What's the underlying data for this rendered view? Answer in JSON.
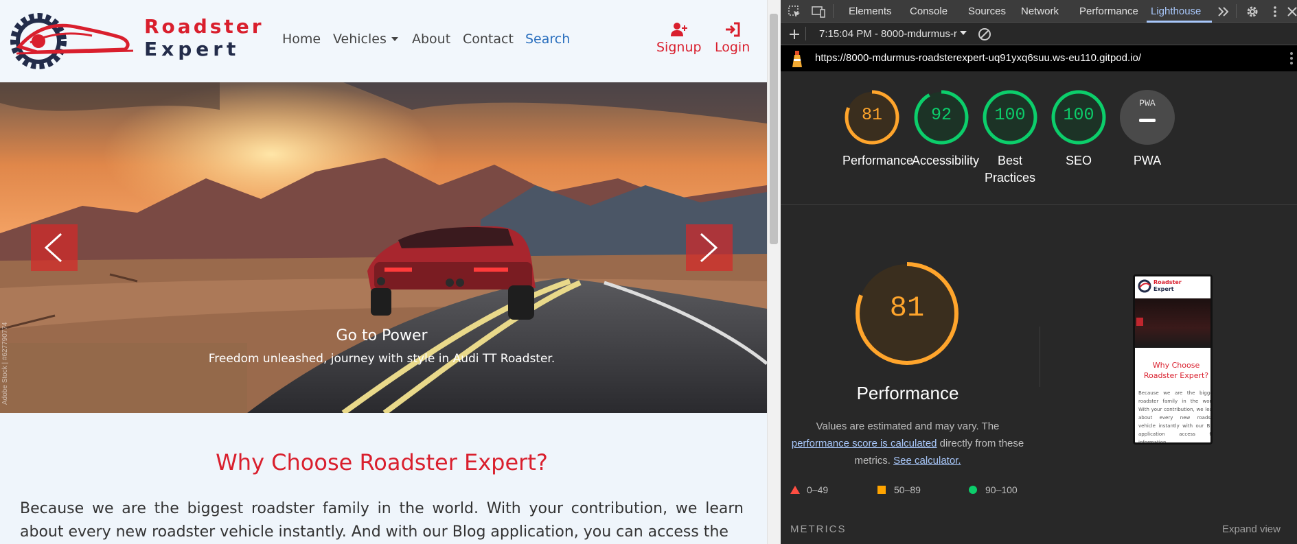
{
  "site": {
    "brand": {
      "line1": "Roadster",
      "line2": "Expert"
    },
    "nav": {
      "home": "Home",
      "vehicles": "Vehicles",
      "about": "About",
      "contact": "Contact",
      "search": "Search",
      "signup": "Signup",
      "login": "Login"
    },
    "hero": {
      "title": "Go to Power",
      "subtitle": "Freedom unleashed, journey with style in Audi TT Roadster.",
      "watermark": "Adobe Stock | #627790774"
    },
    "why": {
      "title": "Why Choose Roadster Expert?",
      "text": "Because we are the biggest roadster family in the world. With your contribution, we learn about every new roadster vehicle instantly. And with our Blog application, you can access the"
    },
    "colors": {
      "accent": "#d91f2d",
      "navy": "#232c4a",
      "link": "#2a6fbe"
    }
  },
  "devtools": {
    "tabs": [
      "Elements",
      "Console",
      "Sources",
      "Network",
      "Performance",
      "Lighthouse"
    ],
    "active_tab": "Lighthouse",
    "report_time": "7:15:04 PM - 8000-mdurmus-r",
    "url": "https://8000-mdurmus-roadsterexpert-uq91yxq6suu.ws-eu110.gitpod.io/",
    "scores": [
      {
        "label": "Performance",
        "value": "81",
        "level": "average",
        "color": "#ffa52c"
      },
      {
        "label": "Accessibility",
        "value": "92",
        "level": "pass",
        "color": "#0cce6b"
      },
      {
        "label": "Best Practices",
        "value": "100",
        "level": "pass",
        "color": "#0cce6b"
      },
      {
        "label": "SEO",
        "value": "100",
        "level": "pass",
        "color": "#0cce6b"
      },
      {
        "label": "PWA",
        "value": "PWA",
        "level": "na",
        "color": "#9e9e9e"
      }
    ],
    "performance": {
      "score": "81",
      "title": "Performance",
      "desc_before": "Values are estimated and may vary. The ",
      "desc_link": "performance score is calculated",
      "desc_mid": " directly from these metrics. ",
      "desc_link2": "See calculator."
    },
    "legend": [
      {
        "range": "0–49",
        "color": "#ff4e42"
      },
      {
        "range": "50–89",
        "color": "#ffa400"
      },
      {
        "range": "90–100",
        "color": "#0cce6b"
      }
    ],
    "metrics_label": "METRICS",
    "expand_label": "Expand view",
    "thumbnail": {
      "brand1": "Roadster",
      "brand2": "Expert",
      "title": "Why Choose Roadster Expert?",
      "text": "Because we are the biggest roadster family in the world. With your contribution, we learn about every new roadster vehicle instantly with our Blog application access the information"
    }
  }
}
